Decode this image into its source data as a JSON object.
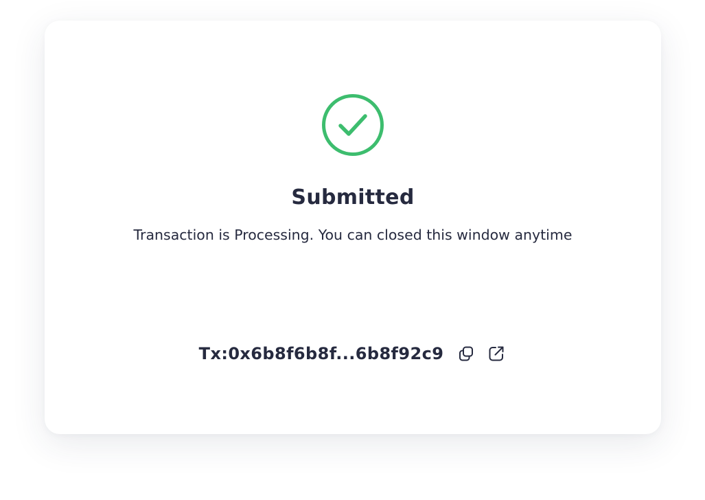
{
  "dialog": {
    "status": "success",
    "title": "Submitted",
    "message": "Transaction is Processing. You can closed this window anytime",
    "transaction": {
      "hash_display": "Tx:0x6b8f6b8f...6b8f92c9"
    },
    "icons": {
      "status": "check-circle-icon",
      "copy": "copy-icon",
      "external": "external-link-icon"
    },
    "colors": {
      "success": "#3dbd6e",
      "text": "#262a3f"
    }
  }
}
